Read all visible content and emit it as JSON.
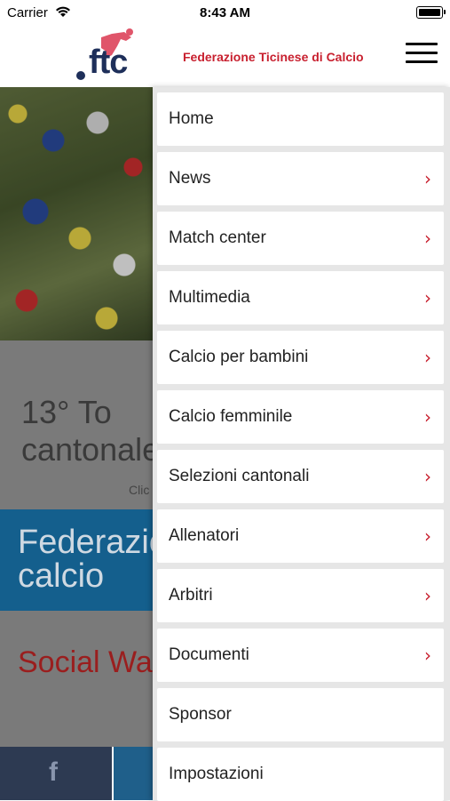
{
  "status_bar": {
    "carrier": "Carrier",
    "time": "8:43 AM"
  },
  "header": {
    "logo_text": "ftc",
    "brand": "Federazione Ticinese di Calcio"
  },
  "background": {
    "event_title_line1": "13° To",
    "event_title_line2": "cantonale",
    "event_sub": "Clic",
    "federation_line1": "Federazio",
    "federation_line2": "calcio",
    "social": "Social Wal",
    "share_facebook": "f"
  },
  "menu": {
    "items": [
      {
        "label": "Home",
        "chevron": false
      },
      {
        "label": "News",
        "chevron": true
      },
      {
        "label": "Match center",
        "chevron": true
      },
      {
        "label": "Multimedia",
        "chevron": true
      },
      {
        "label": "Calcio per bambini",
        "chevron": true
      },
      {
        "label": "Calcio femminile",
        "chevron": true
      },
      {
        "label": "Selezioni cantonali",
        "chevron": true
      },
      {
        "label": "Allenatori",
        "chevron": true
      },
      {
        "label": "Arbitri",
        "chevron": true
      },
      {
        "label": "Documenti",
        "chevron": true
      },
      {
        "label": "Sponsor",
        "chevron": false
      },
      {
        "label": "Impostazioni",
        "chevron": false
      }
    ],
    "chevron_glyph": "›"
  },
  "colors": {
    "brand_red": "#c8202f",
    "brand_navy": "#1e2f5a",
    "federation_blue": "#145f8d"
  }
}
